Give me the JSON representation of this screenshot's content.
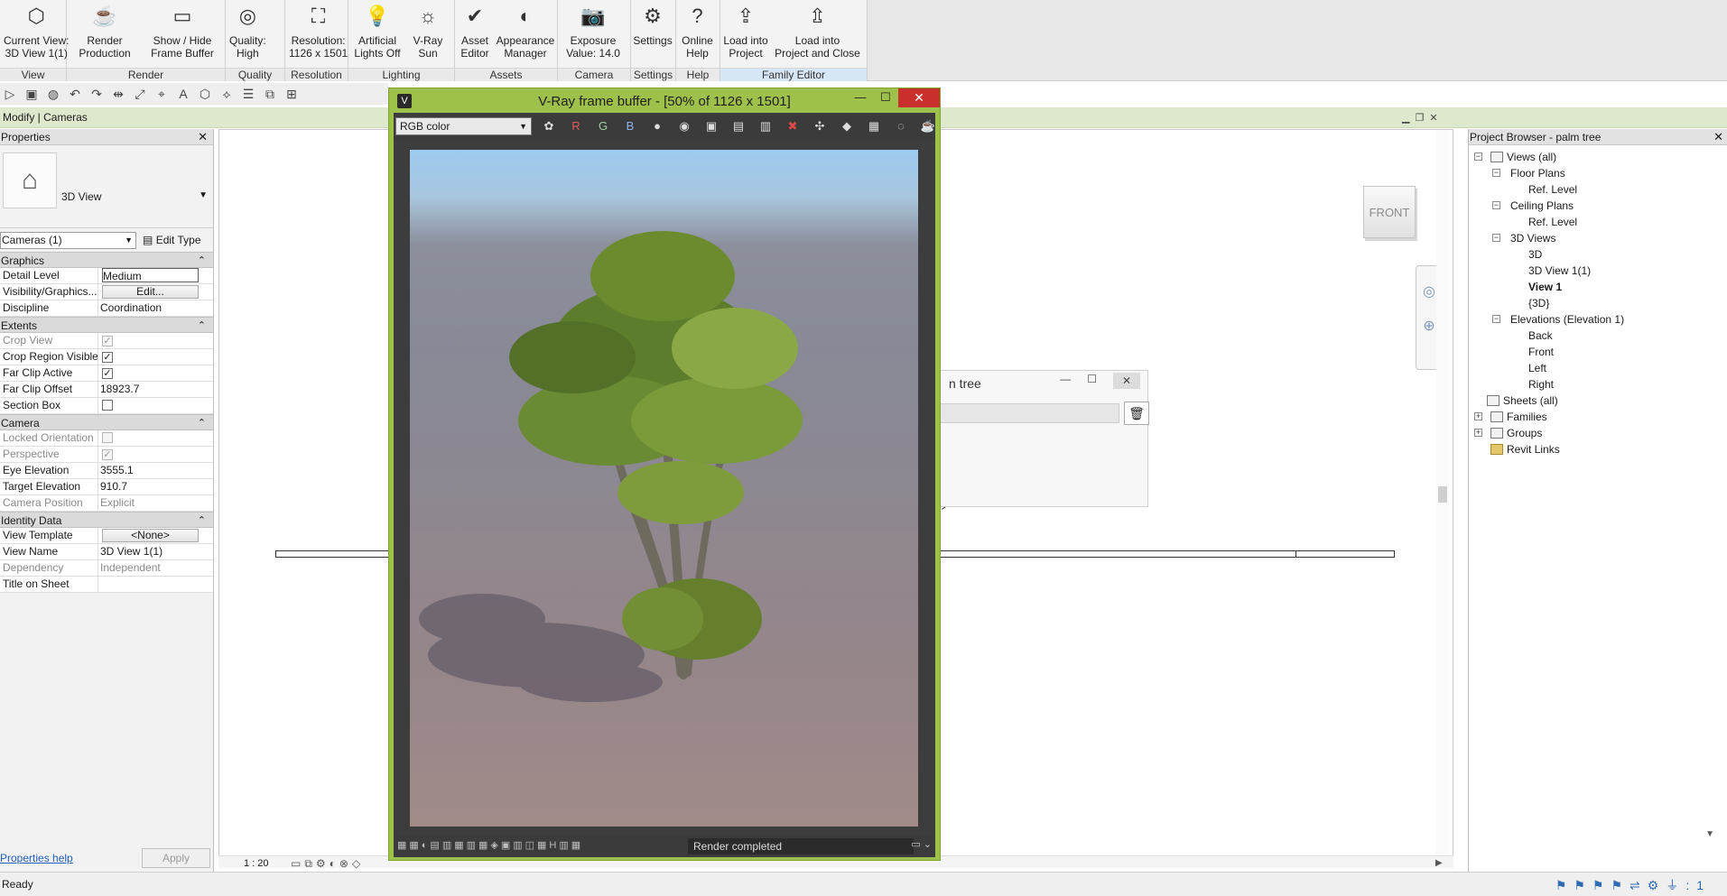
{
  "ribbon": {
    "groups": [
      {
        "title": "View",
        "buttons": [
          {
            "icon": "cube-view-icon",
            "line1": "Current View:",
            "line2": "3D View 1(1)"
          }
        ]
      },
      {
        "title": "Render",
        "buttons": [
          {
            "icon": "teapot-render-icon",
            "line1": "Render",
            "line2": "Production"
          },
          {
            "icon": "frame-buffer-icon",
            "line1": "Show / Hide",
            "line2": "Frame Buffer"
          }
        ]
      },
      {
        "title": "Quality",
        "buttons": [
          {
            "icon": "quality-icon",
            "line1": "Quality:",
            "line2": "High"
          }
        ]
      },
      {
        "title": "Resolution",
        "buttons": [
          {
            "icon": "resolution-icon",
            "line1": "Resolution:",
            "line2": "1126 x 1501"
          }
        ]
      },
      {
        "title": "Lighting",
        "buttons": [
          {
            "icon": "lightbulb-icon",
            "line1": "Artificial",
            "line2": "Lights Off"
          },
          {
            "icon": "sun-icon",
            "line1": "V-Ray",
            "line2": "Sun"
          }
        ]
      },
      {
        "title": "Assets",
        "buttons": [
          {
            "icon": "asset-editor-icon",
            "line1": "Asset",
            "line2": "Editor"
          },
          {
            "icon": "appearance-sphere-icon",
            "line1": "Appearance",
            "line2": "Manager"
          }
        ]
      },
      {
        "title": "Camera",
        "buttons": [
          {
            "icon": "camera-icon",
            "line1": "Exposure",
            "line2": "Value: 14.0"
          }
        ]
      },
      {
        "title": "Settings",
        "buttons": [
          {
            "icon": "gear-icon",
            "line1": "Settings",
            "line2": ""
          }
        ]
      },
      {
        "title": "Help",
        "buttons": [
          {
            "icon": "help-icon",
            "line1": "Online",
            "line2": "Help"
          }
        ]
      },
      {
        "title": "Family Editor",
        "buttons": [
          {
            "icon": "load-into-project-icon",
            "line1": "Load into",
            "line2": "Project"
          },
          {
            "icon": "load-and-close-icon",
            "line1": "Load into",
            "line2": "Project and Close"
          }
        ]
      }
    ]
  },
  "context": {
    "label": "Modify | Cameras"
  },
  "properties": {
    "title": "Properties",
    "type_name": "3D View",
    "filter": "Cameras (1)",
    "edit_type": "Edit Type",
    "sections": {
      "graphics": "Graphics",
      "extents": "Extents",
      "camera": "Camera",
      "identity": "Identity Data"
    },
    "rows": {
      "detail_level": {
        "k": "Detail Level",
        "v": "Medium"
      },
      "visibility": {
        "k": "Visibility/Graphics...",
        "v": "Edit..."
      },
      "discipline": {
        "k": "Discipline",
        "v": "Coordination"
      },
      "crop_view": {
        "k": "Crop View",
        "v": "✓"
      },
      "crop_region": {
        "k": "Crop Region Visible",
        "v": "✓"
      },
      "far_clip_active": {
        "k": "Far Clip Active",
        "v": "✓"
      },
      "far_clip_offset": {
        "k": "Far Clip Offset",
        "v": "18923.7"
      },
      "section_box": {
        "k": "Section Box",
        "v": ""
      },
      "locked_orientation": {
        "k": "Locked Orientation",
        "v": ""
      },
      "perspective": {
        "k": "Perspective",
        "v": "✓"
      },
      "eye_elevation": {
        "k": "Eye Elevation",
        "v": "3555.1"
      },
      "target_elevation": {
        "k": "Target Elevation",
        "v": "910.7"
      },
      "camera_position": {
        "k": "Camera Position",
        "v": "Explicit"
      },
      "view_template": {
        "k": "View Template",
        "v": "<None>"
      },
      "view_name": {
        "k": "View Name",
        "v": "3D View 1(1)"
      },
      "dependency": {
        "k": "Dependency",
        "v": "Independent"
      },
      "title_on_sheet": {
        "k": "Title on Sheet",
        "v": ""
      }
    },
    "help": "Properties help",
    "apply": "Apply"
  },
  "canvas": {
    "scale": "1 : 20",
    "viewcube": "FRONT"
  },
  "bg_dialog": {
    "title": "n tree"
  },
  "vfb": {
    "title": "V-Ray frame buffer - [50% of 1126 x 1501]",
    "channel": "RGB color",
    "tools": {
      "r": "R",
      "g": "G",
      "b": "B"
    },
    "status": "Render completed"
  },
  "browser": {
    "title": "Project Browser - palm tree",
    "nodes": {
      "views_all": "Views (all)",
      "floor_plans": "Floor Plans",
      "fp_ref": "Ref. Level",
      "ceiling_plans": "Ceiling Plans",
      "cp_ref": "Ref. Level",
      "views_3d": "3D Views",
      "v3d": "3D",
      "v3d_view11": "3D View 1(1)",
      "v3d_view1": "View 1",
      "v3d_paren": "{3D}",
      "elevations": "Elevations (Elevation 1)",
      "back": "Back",
      "front": "Front",
      "left": "Left",
      "right": "Right",
      "sheets": "Sheets (all)",
      "families": "Families",
      "groups": "Groups",
      "revit_links": "Revit Links"
    }
  },
  "statusbar": {
    "text": "Ready",
    "filter_count": ":1"
  }
}
